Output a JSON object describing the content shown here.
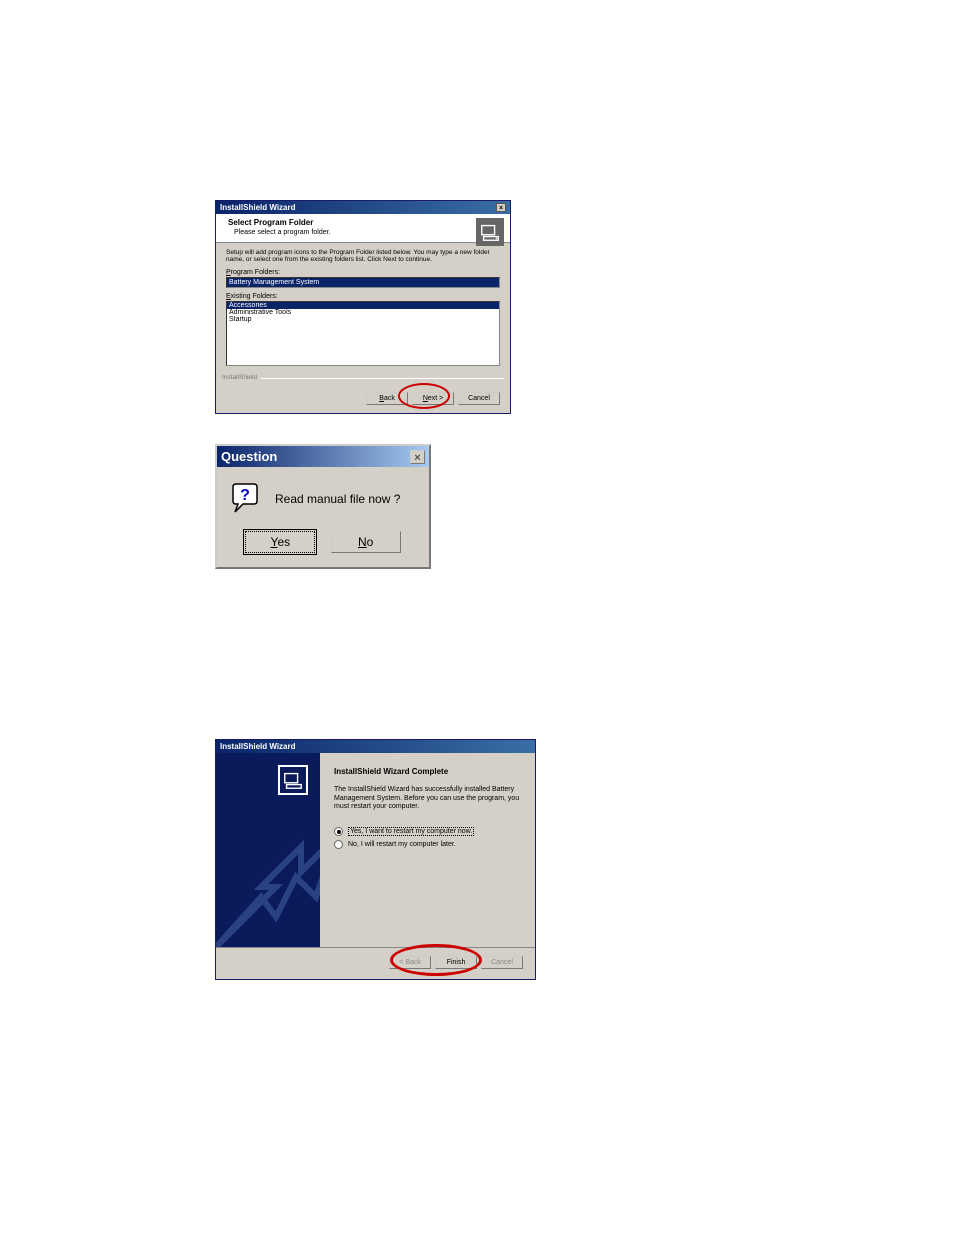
{
  "dialog1": {
    "title": "InstallShield Wizard",
    "close_glyph": "×",
    "header": {
      "title": "Select Program Folder",
      "subtitle": "Please select a program folder."
    },
    "instruction": "Setup will add program icons to the Program Folder listed below. You may type a new folder name, or select one from the existing folders list. Click Next to continue.",
    "program_folders_label_prefix": "P",
    "program_folders_label_rest": "rogram Folders:",
    "program_folders_value": "Battery Management System",
    "existing_folders_label_prefix": "E",
    "existing_folders_label_rest": "xisting Folders:",
    "existing_folders": {
      "selected": "Accessories",
      "items": [
        "Administrative Tools",
        "Startup"
      ]
    },
    "separator": "InstallShield",
    "buttons": {
      "back": "< Back",
      "next_prefix": "N",
      "next_rest": "ext >",
      "cancel": "Cancel"
    }
  },
  "dialog2": {
    "title": "Question",
    "close_glyph": "×",
    "message": "Read manual file now ?",
    "yes_prefix": "Y",
    "yes_rest": "es",
    "no_prefix": "N",
    "no_rest": "o"
  },
  "dialog3": {
    "title": "InstallShield Wizard",
    "heading": "InstallShield Wizard Complete",
    "body": "The InstallShield Wizard has successfully installed Battery Management System. Before you can use the program, you must restart your computer.",
    "radio_yes": "Yes, I want to restart my computer now.",
    "radio_no": "No, I will restart my computer later.",
    "buttons": {
      "back": "< Back",
      "finish": "Finish",
      "cancel": "Cancel"
    }
  }
}
